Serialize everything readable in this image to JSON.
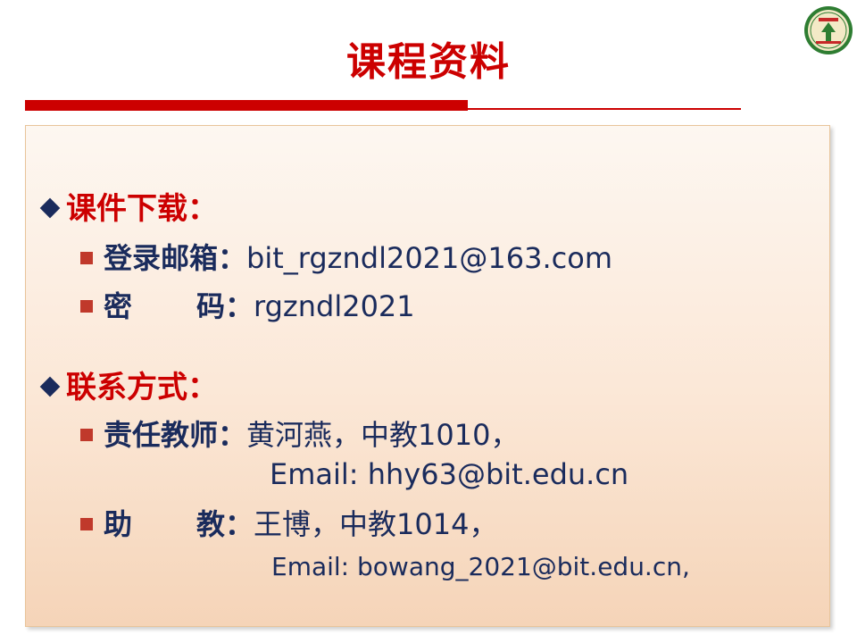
{
  "slide": {
    "title": "课程资料"
  },
  "section_materials": {
    "heading": "课件下载：",
    "items": [
      {
        "label": "登录邮箱：",
        "value": "bit_rgzndl2021@163.com"
      },
      {
        "label_a": "密",
        "label_b": "码：",
        "value": "rgzndl2021"
      }
    ]
  },
  "section_contact": {
    "heading": "联系方式：",
    "teacher": {
      "label": "责任教师：",
      "value": "黄河燕，中教1010，",
      "email": "Email: hhy63@bit.edu.cn"
    },
    "assistant": {
      "label_a": "助",
      "label_b": "教：",
      "value": "王博，中教1014，",
      "email": "Email: bowang_2021@bit.edu.cn,"
    }
  },
  "colors": {
    "accent_red": "#cc0000",
    "text_navy": "#1a2b5c",
    "logo_green": "#2e7d32"
  },
  "icons": {
    "logo": "university-seal-icon",
    "heading_bullet": "diamond-bullet-icon",
    "item_bullet": "square-bullet-icon"
  }
}
